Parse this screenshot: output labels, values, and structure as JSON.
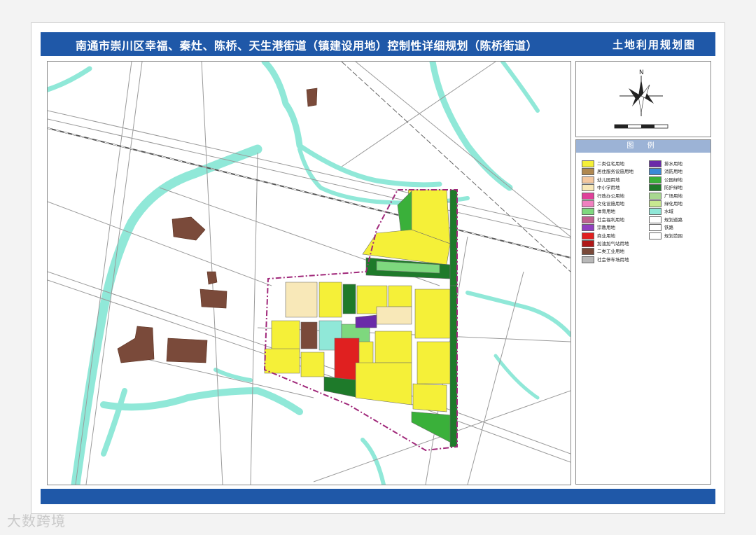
{
  "title": {
    "main": "南通市崇川区幸福、秦灶、陈桥、天生港街道（镇建设用地）控制性详细规划（陈桥街道）",
    "sub": "土地利用规划图"
  },
  "compass": {
    "north_label": "N"
  },
  "legend": {
    "header": "图 例",
    "left_items": [
      {
        "label": "二类住宅用地",
        "color": "#f5f038"
      },
      {
        "label": "居住服务设施用地",
        "color": "#b08850"
      },
      {
        "label": "幼儿园用地",
        "color": "#f4c8a0"
      },
      {
        "label": "中小学用地",
        "color": "#f8e8b8"
      },
      {
        "label": "行政办公用地",
        "color": "#e0409a"
      },
      {
        "label": "文化设施用地",
        "color": "#f080c0"
      },
      {
        "label": "体育用地",
        "color": "#7ed87e"
      },
      {
        "label": "社会福利用地",
        "color": "#c06090"
      },
      {
        "label": "宗教用地",
        "color": "#9040c0"
      },
      {
        "label": "商业用地",
        "color": "#e02020"
      },
      {
        "label": "加油加气站用地",
        "color": "#b01818"
      },
      {
        "label": "二类工业用地",
        "color": "#7a4a3a"
      },
      {
        "label": "社会停车场用地",
        "color": "#b8b8b8"
      }
    ],
    "right_items": [
      {
        "label": "排水用地",
        "color": "#6a2aa8"
      },
      {
        "label": "消防用地",
        "color": "#3a8ad8"
      },
      {
        "label": "公园绿地",
        "color": "#3ab03a"
      },
      {
        "label": "防护绿地",
        "color": "#1e7a2a"
      },
      {
        "label": "广场用地",
        "color": "#a8d890"
      },
      {
        "label": "绿化用地",
        "color": "#c8e890"
      },
      {
        "label": "水域",
        "color": "#90e8d8"
      },
      {
        "label": "规划道路",
        "color": "#ffffff"
      },
      {
        "label": "铁路",
        "color": "#ffffff"
      },
      {
        "label": "规划范围",
        "color": "#ffffff"
      }
    ]
  },
  "watermark": "大数跨境",
  "colors": {
    "title_bar": "#1f58a8",
    "water": "#90e8d8",
    "residential": "#f5f038",
    "industrial": "#7a4a3a",
    "commercial": "#e02020",
    "park": "#3ab03a",
    "protective_green": "#1e7a2a",
    "boundary": "#a0287a"
  }
}
